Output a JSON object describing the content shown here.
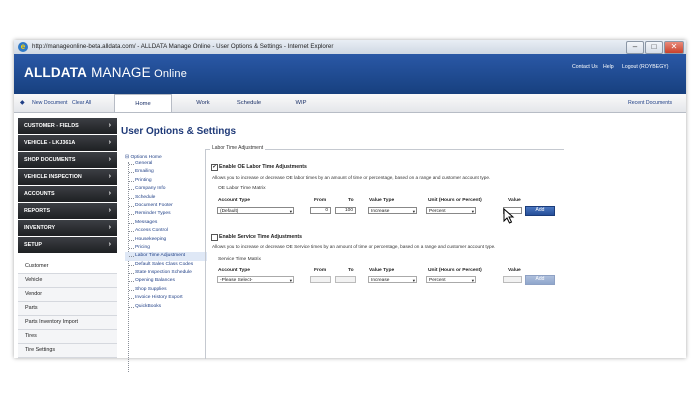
{
  "window": {
    "title": "http://manageonline-beta.alldata.com/ - ALLDATA Manage Online - User Options & Settings - Internet Explorer",
    "ie_icon": "e"
  },
  "header": {
    "logo_bold": "ALLDATA",
    "logo_mid": " MANAGE",
    "logo_suffix": " Online",
    "links": {
      "contact": "Contact Us",
      "help": "Help",
      "logout": "Logout (ROYBEGY)"
    }
  },
  "nav": {
    "new_document": "New Document",
    "clear_all": "Clear All",
    "tabs": [
      "Home",
      "Work",
      "Schedule",
      "WIP"
    ],
    "recent_documents": "Recent Documents"
  },
  "sidebar": {
    "sections": [
      "CUSTOMER - FIELDS",
      "VEHICLE - LKJ361A",
      "SHOP DOCUMENTS",
      "VEHICLE INSPECTION",
      "ACCOUNTS",
      "REPORTS",
      "INVENTORY",
      "SETUP"
    ],
    "sub_items": [
      "Customer",
      "Vehicle",
      "Vendor",
      "Parts",
      "Parts Inventory Import",
      "Tires",
      "Tire Settings"
    ]
  },
  "main": {
    "page_title": "User Options & Settings",
    "tree": {
      "root": "Options Home",
      "items": [
        "General",
        "Emailing",
        "Printing",
        "Company Info",
        "Schedule",
        "Document Footer",
        "Reminder Types",
        "Messages",
        "Access Control",
        "Housekeeping",
        "Pricing",
        "Labor Time Adjustment",
        "Default Sales Class Codes",
        "State Inspection Schedule",
        "Opening Balances",
        "Shop Supplies",
        "Invoice History Export",
        "QuickBooks"
      ],
      "highlighted": "Labor Time Adjustment"
    },
    "section_legend": "Labor Time Adjustment",
    "oe_labor": {
      "checkbox_label": "Enable OE Labor Time Adjustments",
      "checked": true,
      "description": "Allows you to increase or decrease OE labor times by an amount of time or percentage, based on a range and customer account type.",
      "matrix_title": "OE Labor Time Matrix",
      "columns": {
        "account_type": "Account Type",
        "from": "From",
        "to": "To",
        "value_type": "Value Type",
        "unit": "Unit (Hours or Percent)",
        "value": "Value"
      },
      "row": {
        "account_type": "(Default)",
        "from": "0",
        "to": "100",
        "value_type": "Increase",
        "unit": "Percent",
        "value": ""
      },
      "add_label": "Add"
    },
    "service": {
      "checkbox_label": "Enable Service Time Adjustments",
      "checked": false,
      "description": "Allows you to increase or decrease OE Service times by an amount of time or percentage, based on a range and customer account type.",
      "matrix_title": "Service Time Matrix",
      "columns": {
        "account_type": "Account Type",
        "from": "From",
        "to": "To",
        "value_type": "Value Type",
        "unit": "Unit (Hours or Percent)",
        "value": "Value"
      },
      "row": {
        "account_type": "-Please Select-",
        "from": "",
        "to": "",
        "value_type": "Increase",
        "unit": "Percent",
        "value": ""
      },
      "add_label": "Add"
    }
  },
  "icons": {
    "dropdown": "▾",
    "arrow": "›",
    "checkmark": "✔",
    "minimize": "–",
    "maximize": "□",
    "close": "✕"
  }
}
